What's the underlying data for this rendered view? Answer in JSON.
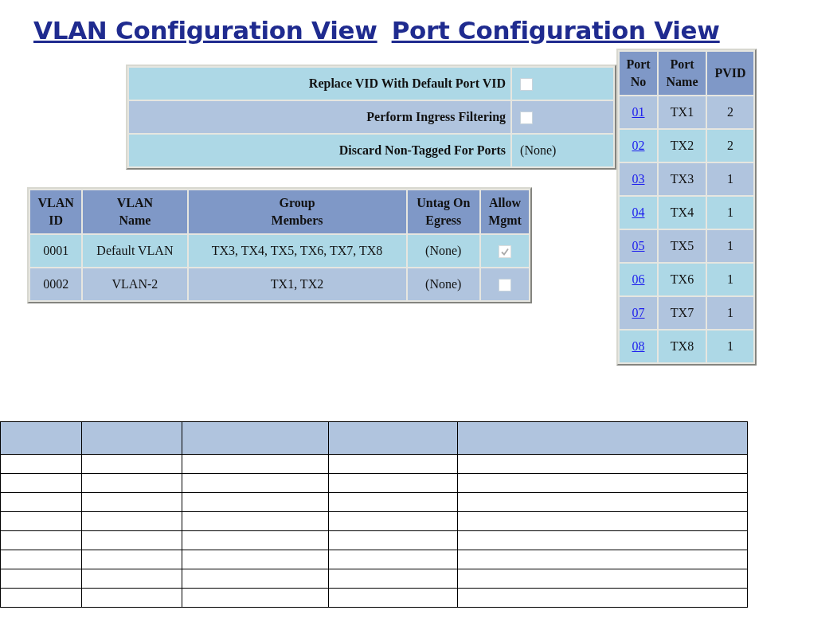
{
  "titles": [
    "VLAN Configuration View",
    "Port Configuration View"
  ],
  "options": [
    {
      "label": "Replace VID With Default Port VID",
      "kind": "checkbox",
      "checked": false
    },
    {
      "label": "Perform Ingress Filtering",
      "kind": "checkbox",
      "checked": false
    },
    {
      "label": "Discard Non-Tagged For Ports",
      "kind": "text",
      "value": "(None)"
    }
  ],
  "vlan_table": {
    "columns": [
      "VLAN\nID",
      "VLAN\nName",
      "Group\nMembers",
      "Untag On\nEgress",
      "Allow\nMgmt"
    ],
    "rows": [
      {
        "id": "0001",
        "name": "Default VLAN",
        "members": "TX3, TX4, TX5, TX6, TX7, TX8",
        "untag": "(None)",
        "allow_mgmt": {
          "checked": true,
          "disabled": true
        }
      },
      {
        "id": "0002",
        "name": "VLAN-2",
        "members": "TX1, TX2",
        "untag": "(None)",
        "allow_mgmt": {
          "checked": false,
          "disabled": false
        }
      }
    ]
  },
  "port_table": {
    "columns": [
      "Port\nNo",
      "Port\nName",
      "PVID"
    ],
    "rows": [
      {
        "port": "01",
        "name": "TX1",
        "pvid": "2"
      },
      {
        "port": "02",
        "name": "TX2",
        "pvid": "2"
      },
      {
        "port": "03",
        "name": "TX3",
        "pvid": "1"
      },
      {
        "port": "04",
        "name": "TX4",
        "pvid": "1"
      },
      {
        "port": "05",
        "name": "TX5",
        "pvid": "1"
      },
      {
        "port": "06",
        "name": "TX6",
        "pvid": "1"
      },
      {
        "port": "07",
        "name": "TX7",
        "pvid": "1"
      },
      {
        "port": "08",
        "name": "TX8",
        "pvid": "1"
      }
    ]
  }
}
